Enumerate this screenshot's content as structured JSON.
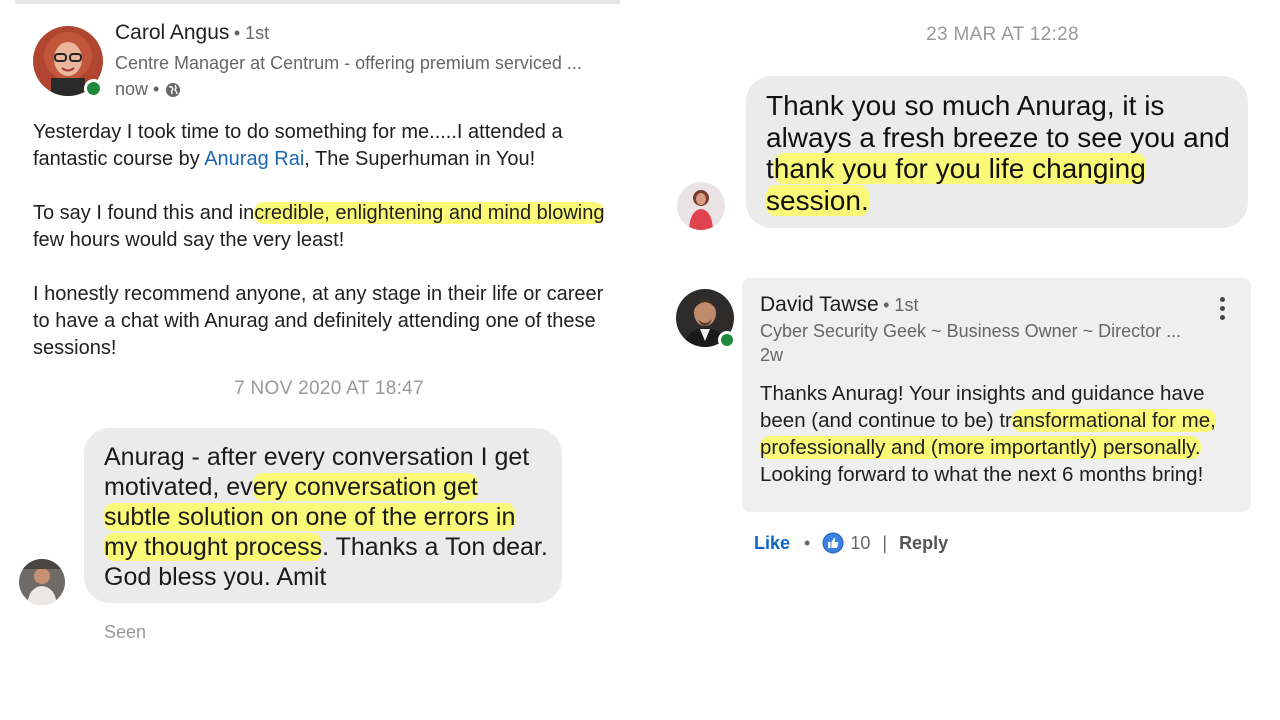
{
  "post": {
    "author": "Carol Angus",
    "degree": "• 1st",
    "headline": "Centre Manager at Centrum - offering premium serviced ...",
    "time": "now •",
    "para1_a": "Yesterday I took time to do something for me.....I attended a fantastic course by ",
    "para1_link": "Anurag Rai",
    "para1_b": ", The Superhuman in You!",
    "para2_a": "To say I found this and in",
    "para2_hl": "credible, enlightening and mind blowing",
    "para2_b": " few hours would say the very least!",
    "para3": "I honestly recommend anyone, at any stage in their life or career to have a chat with Anurag and definitely attending one of these sessions!"
  },
  "chat1": {
    "timestamp": "7 NOV 2020 AT 18:47",
    "msg_a": "Anurag - after every conversation I get motivated, ev",
    "msg_hl": "ery conversation get subtle solution on one of the errors in my thought process",
    "msg_b": ". Thanks a Ton dear. God bless you. Amit",
    "seen": "Seen"
  },
  "chat2": {
    "timestamp": "23 MAR AT 12:28",
    "msg_a": "Thank you so much Anurag, it is always a fresh breeze to see you and t",
    "msg_hl": "hank you for you life changing session.",
    "msg_b": ""
  },
  "comment": {
    "author": "David Tawse",
    "degree": "• 1st",
    "headline": "Cyber Security Geek ~ Business Owner ~ Director ...",
    "time": "2w",
    "text_a": "Thanks Anurag! Your insights and guidance have been (and continue to be) tr",
    "text_hl": "ansformational for me, professionally and (more importantly) personally.",
    "text_b": " Looking forward to what the next 6 months bring!",
    "like_label": "Like",
    "sep": "•",
    "reactions": "10",
    "pipe": "|",
    "reply_label": "Reply"
  },
  "icons": {
    "globe": "globe-icon",
    "more": "more-options-icon",
    "reaction": "like-reaction-icon"
  },
  "colors": {
    "link": "#1a66b3",
    "like": "#0a66c2",
    "highlight": "#fafa78",
    "bubble": "#ebebeb",
    "online": "#1f8a3b"
  }
}
